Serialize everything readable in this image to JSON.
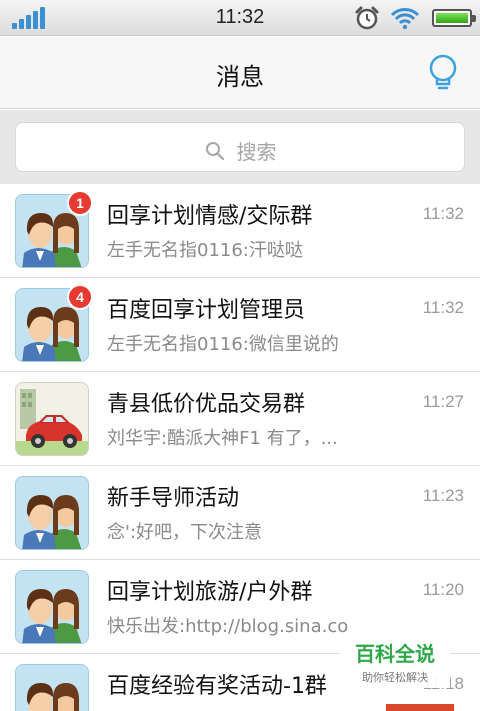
{
  "status_bar": {
    "time": "11:32",
    "icons": [
      "signal-icon",
      "alarm-icon",
      "wifi-icon",
      "battery-icon"
    ],
    "accent_color": "#3c8fd0",
    "battery_level": 0.95
  },
  "header": {
    "title": "消息",
    "right_icon": "lightbulb-icon"
  },
  "search": {
    "placeholder": "搜索",
    "icon": "search-icon"
  },
  "conversations": [
    {
      "name": "回享计划情感/交际群",
      "preview": "左手无名指0116:汗哒哒",
      "time": "11:32",
      "badge": "1",
      "avatar": "couple-avatar"
    },
    {
      "name": "百度回享计划管理员",
      "preview": "左手无名指0116:微信里说的",
      "time": "11:32",
      "badge": "4",
      "avatar": "couple-avatar"
    },
    {
      "name": "青县低价优品交易群",
      "preview": "刘华宇:酷派大神F1 有了，...",
      "time": "11:27",
      "badge": "",
      "avatar": "car-avatar"
    },
    {
      "name": "新手导师活动",
      "preview": "念':好吧，下次注意",
      "time": "11:23",
      "badge": "",
      "avatar": "couple-avatar"
    },
    {
      "name": "回享计划旅游/户外群",
      "preview": "快乐出发:http://blog.sina.co",
      "time": "11:20",
      "badge": "",
      "avatar": "couple-avatar"
    },
    {
      "name": "百度经验有奖活动-1群",
      "preview": "",
      "time": "11:18",
      "badge": "",
      "avatar": "couple-avatar"
    }
  ],
  "watermark": {
    "main": "百科全说",
    "sub": "助你轻松解决"
  },
  "colors": {
    "badge": "#e63a32",
    "watermark_green": "#2fa84a"
  }
}
